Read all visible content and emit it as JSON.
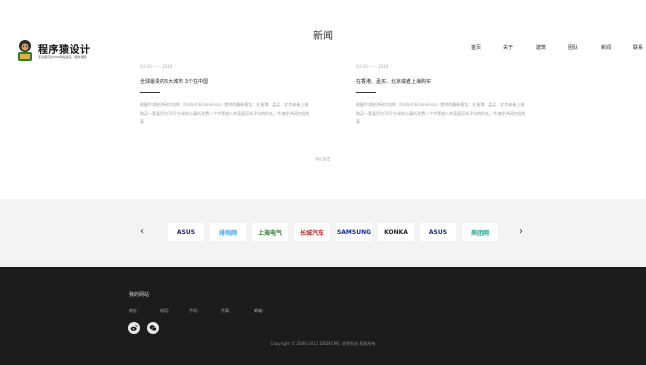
{
  "section": {
    "title": "新闻"
  },
  "logo": {
    "text": "程序猿设计",
    "subtitle": "专注程序猿CMS网站建设 · 服务保障"
  },
  "nav": {
    "items": [
      "首页",
      "关于",
      "建筑",
      "团队",
      "新闻",
      "联系"
    ]
  },
  "news": [
    {
      "date": "03-26 —— 2019",
      "headline": "全球最贵的5大城市 3个在中国",
      "excerpt": "根据牛津经济研究机构（Oxford Economics）提供的最新报告：在香港、孟买、北京或者上海购买一套面积为70平方米的公寓所花费一个中等收入的家庭历年平均的时长。牛津经济研究机构表"
    },
    {
      "date": "03-26 —— 2019",
      "headline": "在香港、孟买、北京或者上海购买",
      "excerpt": "根据牛津经济研究机构（Oxford Economics）提供的最新报告：在香港、孟买、北京或者上海购买一套面积为70平方米的公寓所花费一个中等收入的家庭历年平均的时长。牛津经济研究机构表"
    }
  ],
  "more_label": "MORE",
  "partners": {
    "prev": "‹",
    "next": "›",
    "logos": [
      {
        "name": "ASUS",
        "color": "#1a2a6c"
      },
      {
        "name": "排挡网",
        "color": "#3da9e0"
      },
      {
        "name": "上海电气",
        "color": "#2e7d32"
      },
      {
        "name": "长城汽车",
        "color": "#c62828"
      },
      {
        "name": "SAMSUNG",
        "color": "#1428a0"
      },
      {
        "name": "KONKA",
        "color": "#222222"
      },
      {
        "name": "ASUS",
        "color": "#1a2a6c"
      },
      {
        "name": "美团网",
        "color": "#1aa88e"
      }
    ]
  },
  "footer": {
    "title": "我的网站",
    "contacts": {
      "address": "地址：",
      "phone": "电话：",
      "mobile": "手机：",
      "fax": "传真：",
      "email": "邮箱："
    },
    "copyright": "Copyright © 2004-2011 DEDECMS. 织梦科技 版权所有"
  },
  "colors": {
    "footer_bg": "#1c1c1c",
    "band_bg": "#f3f3f3"
  }
}
